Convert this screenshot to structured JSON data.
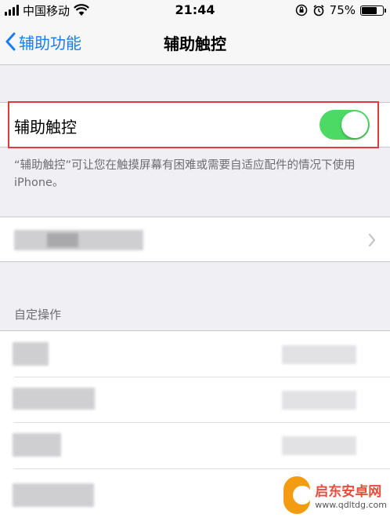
{
  "status_bar": {
    "carrier": "中国移动",
    "time": "21:44",
    "battery_percent": "75%",
    "battery_level": 0.75
  },
  "nav": {
    "back_label": "辅助功能",
    "title": "辅助触控"
  },
  "toggle_row": {
    "label": "辅助触控",
    "enabled": true,
    "toggle_color": "#4cd964"
  },
  "footnote": "“辅助触控”可让您在触摸屏幕有困难或需要自适应配件的情况下使用 iPhone。",
  "custom_actions": {
    "header": "自定操作"
  },
  "watermark": {
    "title": "启东安卓网",
    "url": "www.qdltdg.com"
  },
  "colors": {
    "accent": "#1a7cf5",
    "highlight_border": "#e0393e",
    "background": "#efeff4"
  }
}
